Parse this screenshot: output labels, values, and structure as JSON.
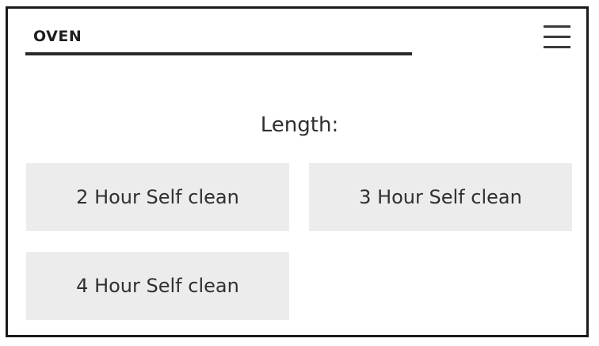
{
  "header": {
    "title": "OVEN"
  },
  "menu": {
    "icon": "hamburger-menu-icon"
  },
  "length_label": "Length:",
  "options": [
    {
      "label": "2 Hour Self clean"
    },
    {
      "label": "3 Hour Self clean"
    },
    {
      "label": "4 Hour Self clean"
    }
  ],
  "colors": {
    "option_background": "#ececec",
    "frame_border": "#1a1a1a",
    "text": "#2b2b2b"
  }
}
